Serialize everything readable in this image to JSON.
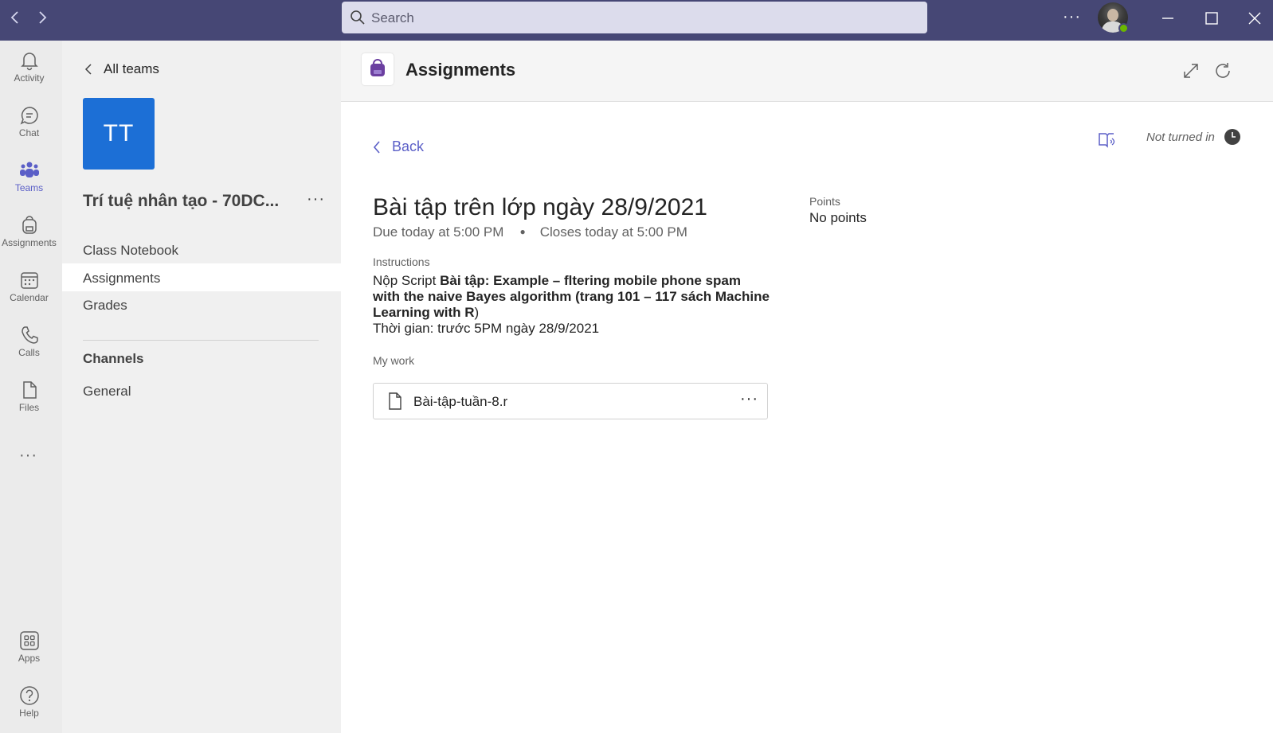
{
  "titlebar": {
    "search_placeholder": "Search",
    "more_label": "···",
    "status_color": "#6bb700"
  },
  "rail": {
    "items": [
      {
        "label": "Activity",
        "icon": "bell-icon"
      },
      {
        "label": "Chat",
        "icon": "chat-icon"
      },
      {
        "label": "Teams",
        "icon": "teams-icon",
        "active": true
      },
      {
        "label": "Assignments",
        "icon": "backpack-icon"
      },
      {
        "label": "Calendar",
        "icon": "calendar-icon"
      },
      {
        "label": "Calls",
        "icon": "phone-icon"
      },
      {
        "label": "Files",
        "icon": "file-icon"
      },
      {
        "label": "Apps",
        "icon": "apps-icon"
      },
      {
        "label": "Help",
        "icon": "help-icon"
      }
    ],
    "more_label": "···"
  },
  "team": {
    "all_teams_label": "All teams",
    "tile_initials": "TT",
    "tile_color": "#1c6fd6",
    "name": "Trí tuệ nhân tạo - 70DC...",
    "more_label": "···",
    "links": [
      "Class Notebook",
      "Assignments",
      "Grades"
    ],
    "active_link": "Assignments",
    "channels_heading": "Channels",
    "channels": [
      "General"
    ]
  },
  "header": {
    "title": "Assignments",
    "accent": "#5b5fc7"
  },
  "assignment": {
    "back_label": "Back",
    "status": "Not turned in",
    "title": "Bài tập trên lớp ngày 28/9/2021",
    "due": "Due today at 5:00 PM",
    "dot": "●",
    "closes": "Closes today at 5:00 PM",
    "points_label": "Points",
    "points_value": "No points",
    "instructions_label": "Instructions",
    "instructions_prefix": "Nộp Script ",
    "instructions_bold": "Bài tập: Example – fltering mobile phone spam with the naive Bayes algorithm (trang 101 – 117 sách Machine Learning with R",
    "instructions_suffix": ")",
    "instructions_line2": "Thời gian: trước 5PM ngày 28/9/2021",
    "my_work_label": "My work",
    "file_name": "Bài-tập-tuần-8.r",
    "file_more": "···"
  }
}
